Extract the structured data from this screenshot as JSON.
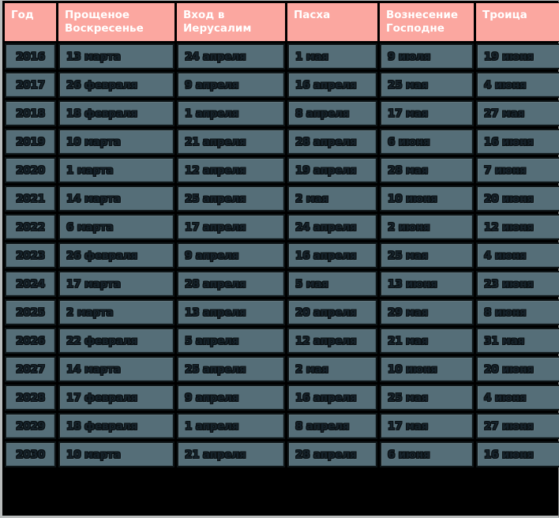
{
  "table": {
    "columns": [
      "Год",
      "Прощеное Воскресенье",
      "Вход в Иерусалим",
      "Пасха",
      "Вознесение Господне",
      "Троица"
    ],
    "rows": [
      {
        "year": "2016",
        "forgiveness_sunday": "13 марта",
        "palm_sunday": "24 апреля",
        "easter": "1 мая",
        "ascension": "9 июля",
        "trinity": "19 июня"
      },
      {
        "year": "2017",
        "forgiveness_sunday": "26 февраля",
        "palm_sunday": "9 апреля",
        "easter": "16 апреля",
        "ascension": "25 мая",
        "trinity": "4 июня"
      },
      {
        "year": "2018",
        "forgiveness_sunday": "18 февраля",
        "palm_sunday": "1 апреля",
        "easter": "8 апреля",
        "ascension": "17 мая",
        "trinity": "27  мая"
      },
      {
        "year": "2019",
        "forgiveness_sunday": "10 марта",
        "palm_sunday": "21 апреля",
        "easter": "28 апреля",
        "ascension": "6 июня",
        "trinity": "16 июня"
      },
      {
        "year": "2020",
        "forgiveness_sunday": "1 марта",
        "palm_sunday": "12 апреля",
        "easter": "19 апреля",
        "ascension": "28 мая",
        "trinity": "7 июня"
      },
      {
        "year": "2021",
        "forgiveness_sunday": "14 марта",
        "palm_sunday": "25 апреля",
        "easter": "2 мая",
        "ascension": "10 июня",
        "trinity": "20 июня"
      },
      {
        "year": "2022",
        "forgiveness_sunday": "6 марта",
        "palm_sunday": "17 апреля",
        "easter": "24 апреля",
        "ascension": "2 июня",
        "trinity": "12 июня"
      },
      {
        "year": "2023",
        "forgiveness_sunday": "26 февраля",
        "palm_sunday": "9 апреля",
        "easter": "16 апреля",
        "ascension": "25 мая",
        "trinity": "4 июня"
      },
      {
        "year": "2024",
        "forgiveness_sunday": "17 марта",
        "palm_sunday": "28 апреля",
        "easter": "5 мая",
        "ascension": "13 июня",
        "trinity": "23 июня"
      },
      {
        "year": "2025",
        "forgiveness_sunday": "2 марта",
        "palm_sunday": "13 апреля",
        "easter": "20 апреля",
        "ascension": "29 мая",
        "trinity": "8 июня"
      },
      {
        "year": "2026",
        "forgiveness_sunday": "22 февраля",
        "palm_sunday": "5 апреля",
        "easter": "12 апреля",
        "ascension": "21 мая",
        "trinity": "31 мая"
      },
      {
        "year": "2027",
        "forgiveness_sunday": "14 марта",
        "palm_sunday": "25 апреля",
        "easter": "2 мая",
        "ascension": "10 июня",
        "trinity": "20 июня"
      },
      {
        "year": "2028",
        "forgiveness_sunday": "17 февраля",
        "palm_sunday": "9 апреля",
        "easter": "16 апреля",
        "ascension": "25 мая",
        "trinity": "4 июня"
      },
      {
        "year": "2029",
        "forgiveness_sunday": "18 февраля",
        "palm_sunday": "1 апреля",
        "easter": "8 апреля",
        "ascension": "17 мая",
        "trinity": "27 июня"
      },
      {
        "year": "2030",
        "forgiveness_sunday": "10 марта",
        "palm_sunday": "21 апреля",
        "easter": "28 апреля",
        "ascension": "6 июня",
        "trinity": "16 июня"
      }
    ]
  },
  "colors": {
    "header_background": "#fba7a0",
    "header_text": "#ffffff",
    "cell_background": "#556e78",
    "cell_text": "#16222a",
    "grid": "#000000",
    "frame": "#b9bcbc"
  }
}
